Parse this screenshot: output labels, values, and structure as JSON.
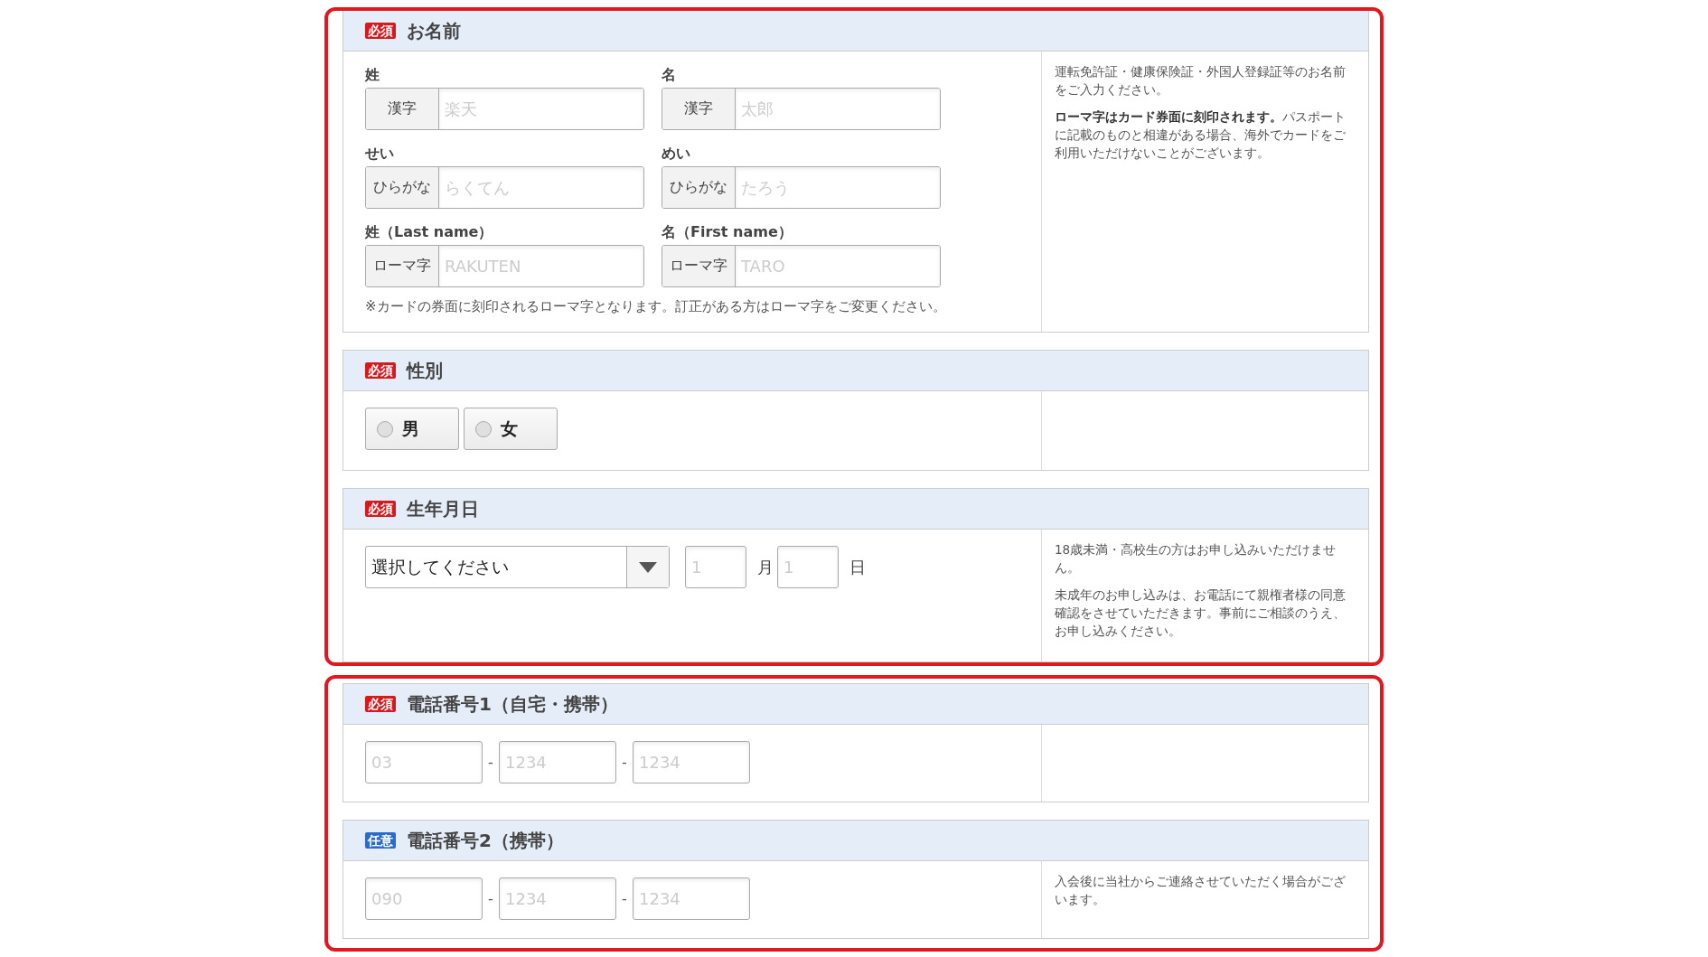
{
  "groups": [
    {
      "sections": [
        {
          "kind": "name",
          "badge": {
            "kind": "required",
            "label": "必須"
          },
          "title": "お名前",
          "fields": [
            {
              "label": "姓",
              "prefix": "漢字",
              "placeholder": "楽天"
            },
            {
              "label": "名",
              "prefix": "漢字",
              "placeholder": "太郎"
            },
            {
              "label": "せい",
              "prefix": "ひらがな",
              "placeholder": "らくてん"
            },
            {
              "label": "めい",
              "prefix": "ひらがな",
              "placeholder": "たろう"
            },
            {
              "label": "姓（Last name）",
              "prefix": "ローマ字",
              "placeholder": "RAKUTEN"
            },
            {
              "label": "名（First name）",
              "prefix": "ローマ字",
              "placeholder": "TARO"
            }
          ],
          "footnote": "※カードの券面に刻印されるローマ字となります。訂正がある方はローマ字をご変更ください。",
          "notes": [
            "運転免許証・健康保険証・外国人登録証等のお名前をご入力ください。",
            "**ローマ字はカード券面に刻印されます。**パスポートに記載のものと相違がある場合、海外でカードをご利用いただけないことがございます。"
          ]
        },
        {
          "kind": "gender",
          "badge": {
            "kind": "required",
            "label": "必須"
          },
          "title": "性別",
          "options": [
            {
              "label": "男",
              "selected": false
            },
            {
              "label": "女",
              "selected": false
            }
          ]
        },
        {
          "kind": "birthdate",
          "badge": {
            "kind": "required",
            "label": "必須"
          },
          "title": "生年月日",
          "select": {
            "value": "選択してください"
          },
          "parts": [
            {
              "placeholder": "1",
              "unit": "月"
            },
            {
              "placeholder": "1",
              "unit": "日"
            }
          ],
          "notes": [
            "18歳未満・高校生の方はお申し込みいただけません。",
            "未成年のお申し込みは、お電話にて親権者様の同意確認をさせていただきます。事前にご相談のうえ、お申し込みください。"
          ]
        }
      ]
    },
    {
      "sections": [
        {
          "kind": "phone",
          "badge": {
            "kind": "required",
            "label": "必須"
          },
          "title": "電話番号1（自宅・携帯）",
          "parts": [
            {
              "placeholder": "03"
            },
            {
              "separator": "-",
              "placeholder": "1234"
            },
            {
              "separator": "-",
              "placeholder": "1234"
            }
          ]
        },
        {
          "kind": "phone",
          "badge": {
            "kind": "optional",
            "label": "任意"
          },
          "title": "電話番号2（携帯）",
          "parts": [
            {
              "placeholder": "090"
            },
            {
              "separator": "-",
              "placeholder": "1234"
            },
            {
              "separator": "-",
              "placeholder": "1234"
            }
          ],
          "notes": [
            "入会後に当社からご連絡させていただく場合がございます。"
          ]
        }
      ]
    }
  ]
}
